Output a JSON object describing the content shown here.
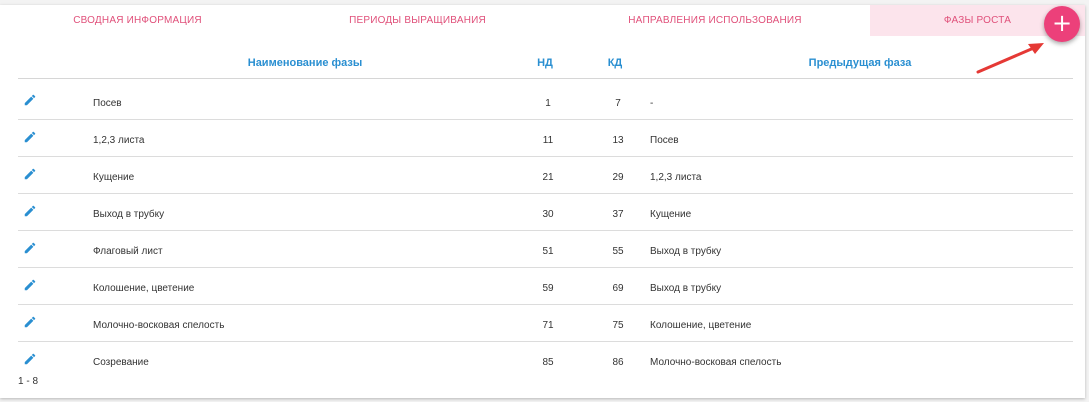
{
  "tabs": [
    {
      "label": "СВОДНАЯ ИНФОРМАЦИЯ",
      "active": false
    },
    {
      "label": "ПЕРИОДЫ ВЫРАЩИВАНИЯ",
      "active": false
    },
    {
      "label": "НАПРАВЛЕНИЯ ИСПОЛЬЗОВАНИЯ",
      "active": false
    },
    {
      "label": "ФАЗЫ РОСТА",
      "active": true
    }
  ],
  "fab": {
    "label": "+",
    "icon": "plus-icon",
    "color": "#ec407a"
  },
  "table": {
    "headers": {
      "name": "Наименование фазы",
      "nd": "НД",
      "kd": "КД",
      "prev": "Предыдущая фаза"
    },
    "rows": [
      {
        "name": "Посев",
        "nd": "1",
        "kd": "7",
        "prev": "-"
      },
      {
        "name": "1,2,3 листа",
        "nd": "11",
        "kd": "13",
        "prev": "Посев"
      },
      {
        "name": "Кущение",
        "nd": "21",
        "kd": "29",
        "prev": "1,2,3 листа"
      },
      {
        "name": "Выход в трубку",
        "nd": "30",
        "kd": "37",
        "prev": "Кущение"
      },
      {
        "name": "Флаговый лист",
        "nd": "51",
        "kd": "55",
        "prev": "Выход в трубку"
      },
      {
        "name": "Колошение, цветение",
        "nd": "59",
        "kd": "69",
        "prev": "Выход в трубку"
      },
      {
        "name": "Молочно-восковая спелость",
        "nd": "71",
        "kd": "75",
        "prev": "Колошение, цветение"
      },
      {
        "name": "Созревание",
        "nd": "85",
        "kd": "86",
        "prev": "Молочно-восковая спелость"
      }
    ]
  },
  "pagination": {
    "range": "1 - 8"
  },
  "colors": {
    "accent": "#e0507a",
    "header_text": "#2a8fd1",
    "active_tab_bg": "#fce4ec",
    "annotation_arrow": "#e53935"
  }
}
